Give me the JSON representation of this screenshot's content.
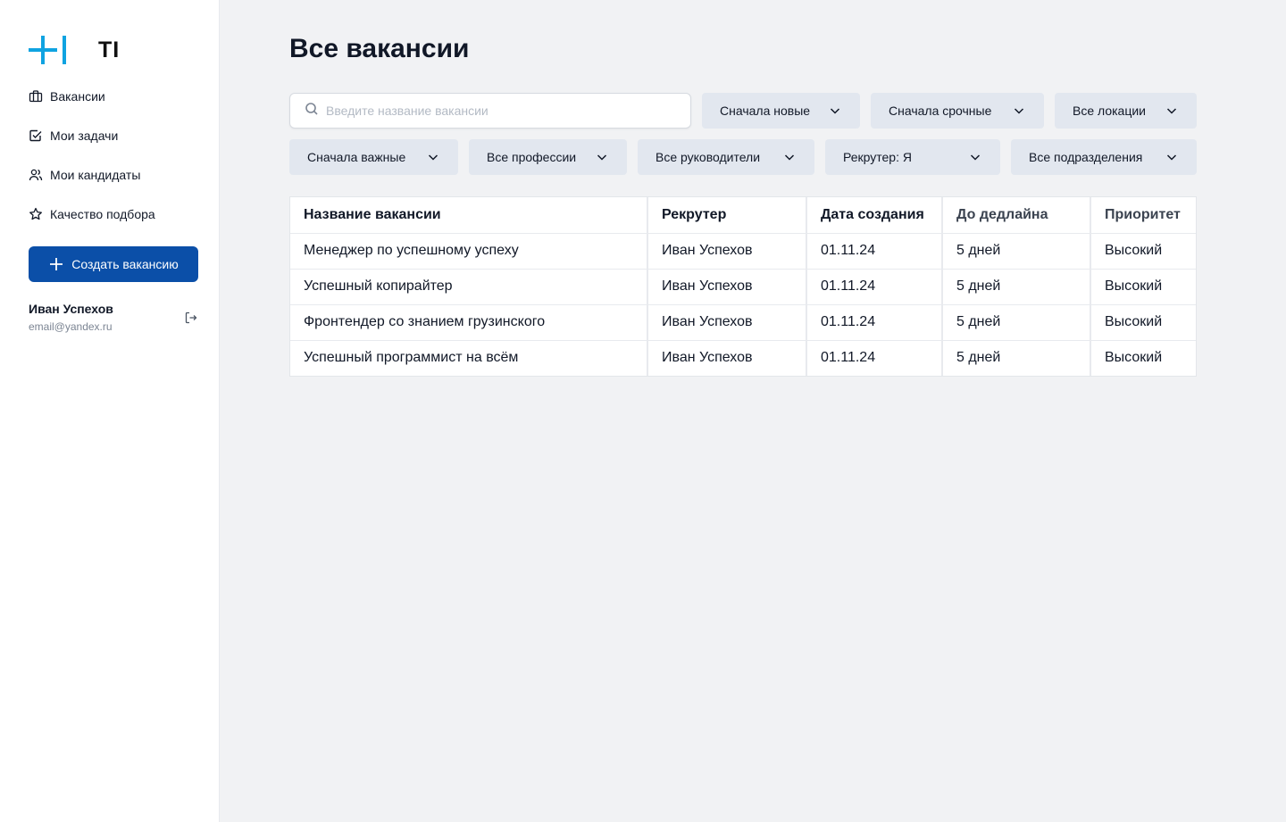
{
  "brand": {
    "logo_text": "TI",
    "accent": "#0fa3e1",
    "primary": "#0b4fa8"
  },
  "sidebar": {
    "items": [
      {
        "label": "Вакансии",
        "icon": "briefcase-icon"
      },
      {
        "label": "Мои задачи",
        "icon": "checkbox-icon"
      },
      {
        "label": "Мои кандидаты",
        "icon": "users-icon"
      },
      {
        "label": "Качество подбора",
        "icon": "star-icon"
      }
    ],
    "create_button": "Создать вакансию",
    "user": {
      "name": "Иван Успехов",
      "email": "email@yandex.ru"
    }
  },
  "main": {
    "title": "Все вакансии",
    "search": {
      "placeholder": "Введите название вакансии",
      "value": ""
    },
    "filters": {
      "sort_new": "Сначала новые",
      "sort_urgent": "Сначала срочные",
      "locations": "Все локации",
      "sort_important": "Сначала важные",
      "professions": "Все профессии",
      "managers": "Все руководители",
      "recruiter": "Рекрутер: Я",
      "departments": "Все подразделения"
    },
    "table": {
      "headers": [
        "Название вакансии",
        "Рекрутер",
        "Дата создания",
        "До дедлайна",
        "Приоритет"
      ],
      "rows": [
        [
          "Менеджер по успешному успеху",
          "Иван Успехов",
          "01.11.24",
          "5 дней",
          "Высокий"
        ],
        [
          "Успешный копирайтер",
          "Иван Успехов",
          "01.11.24",
          "5 дней",
          "Высокий"
        ],
        [
          "Фронтендер со знанием грузинского",
          "Иван Успехов",
          "01.11.24",
          "5 дней",
          "Высокий"
        ],
        [
          "Успешный программист на всём",
          "Иван Успехов",
          "01.11.24",
          "5 дней",
          "Высокий"
        ]
      ]
    }
  }
}
